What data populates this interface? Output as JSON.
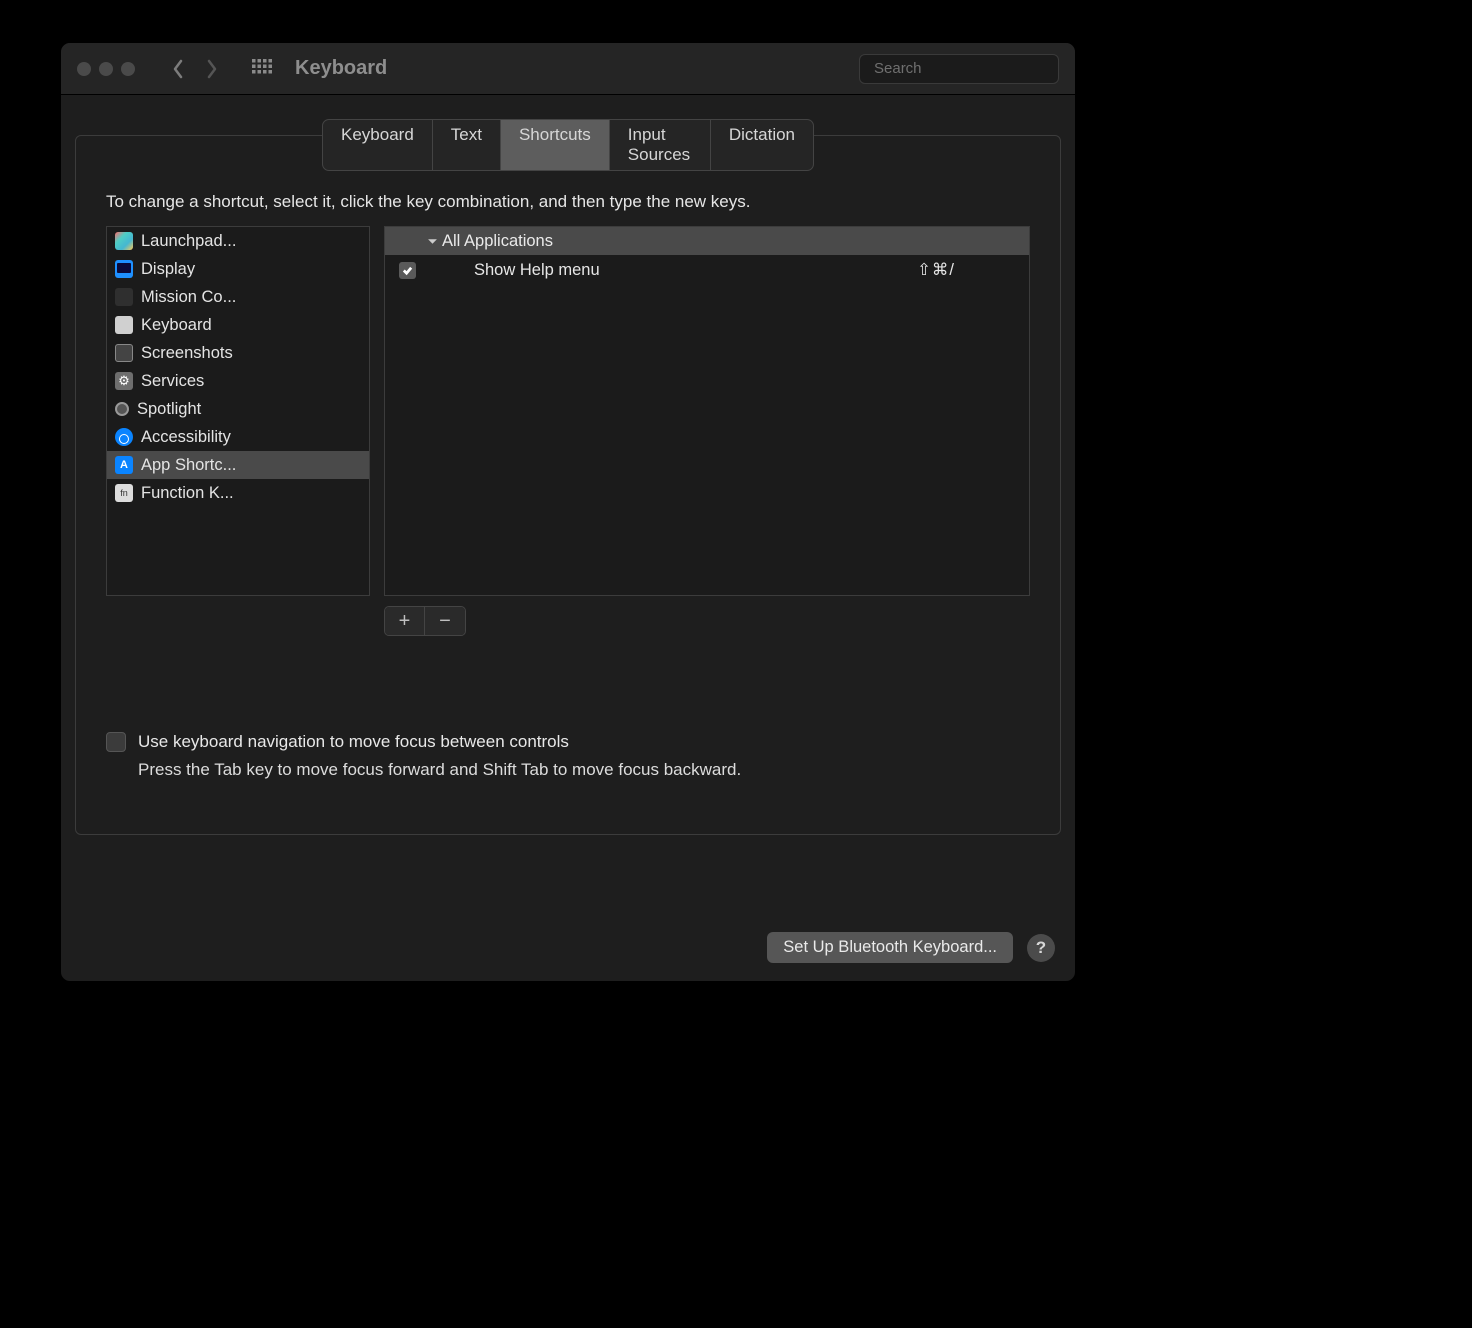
{
  "window": {
    "title": "Keyboard"
  },
  "search": {
    "placeholder": "Search"
  },
  "tabs": [
    "Keyboard",
    "Text",
    "Shortcuts",
    "Input Sources",
    "Dictation"
  ],
  "activeTab": 2,
  "instruction": "To change a shortcut, select it, click the key combination, and then type the new keys.",
  "categories": [
    {
      "label": "Launchpad...",
      "icon": "launchpad"
    },
    {
      "label": "Display",
      "icon": "display"
    },
    {
      "label": "Mission Co...",
      "icon": "mission"
    },
    {
      "label": "Keyboard",
      "icon": "keyboard"
    },
    {
      "label": "Screenshots",
      "icon": "screenshots"
    },
    {
      "label": "Services",
      "icon": "services"
    },
    {
      "label": "Spotlight",
      "icon": "spotlight"
    },
    {
      "label": "Accessibility",
      "icon": "accessibility"
    },
    {
      "label": "App Shortc...",
      "icon": "appshortcuts",
      "selected": true
    },
    {
      "label": "Function K...",
      "icon": "fn"
    }
  ],
  "tree": {
    "header": "All Applications",
    "rows": [
      {
        "checked": true,
        "label": "Show Help menu",
        "keys": "⇧⌘/"
      }
    ]
  },
  "buttons": {
    "add": "+",
    "remove": "−"
  },
  "navCheckbox": {
    "label": "Use keyboard navigation to move focus between controls",
    "desc": "Press the Tab key to move focus forward and Shift Tab to move focus backward."
  },
  "footer": {
    "bluetooth": "Set Up Bluetooth Keyboard...",
    "help": "?"
  }
}
